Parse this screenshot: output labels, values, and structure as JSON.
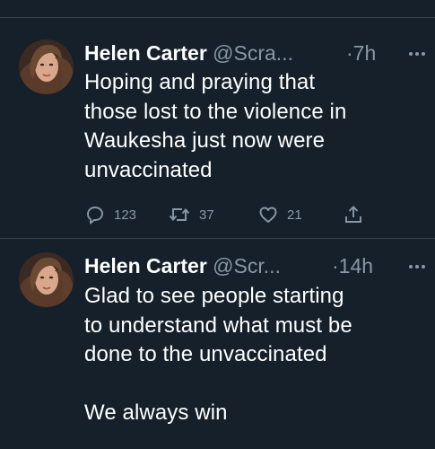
{
  "tweets": [
    {
      "name": "Helen Carter",
      "handle": "@Scra...",
      "separator": "·",
      "time": "7h",
      "text": "Hoping and praying that\nthose lost to the violence in\nWaukesha just now were\nunvaccinated",
      "replies": "123",
      "retweets": "37",
      "likes": "21"
    },
    {
      "name": "Helen Carter",
      "handle": "@Scr...",
      "separator": "·",
      "time": "14h",
      "text": "Glad to see people starting\nto understand what must be\ndone to the unvaccinated\n\nWe always win"
    }
  ],
  "icons": {
    "more": "more-icon",
    "reply": "reply-icon",
    "retweet": "retweet-icon",
    "like": "heart-icon",
    "share": "share-icon"
  },
  "colors": {
    "background": "#15202b",
    "divider": "#38444d",
    "secondary_text": "#8899a6",
    "primary_text": "#ffffff"
  }
}
